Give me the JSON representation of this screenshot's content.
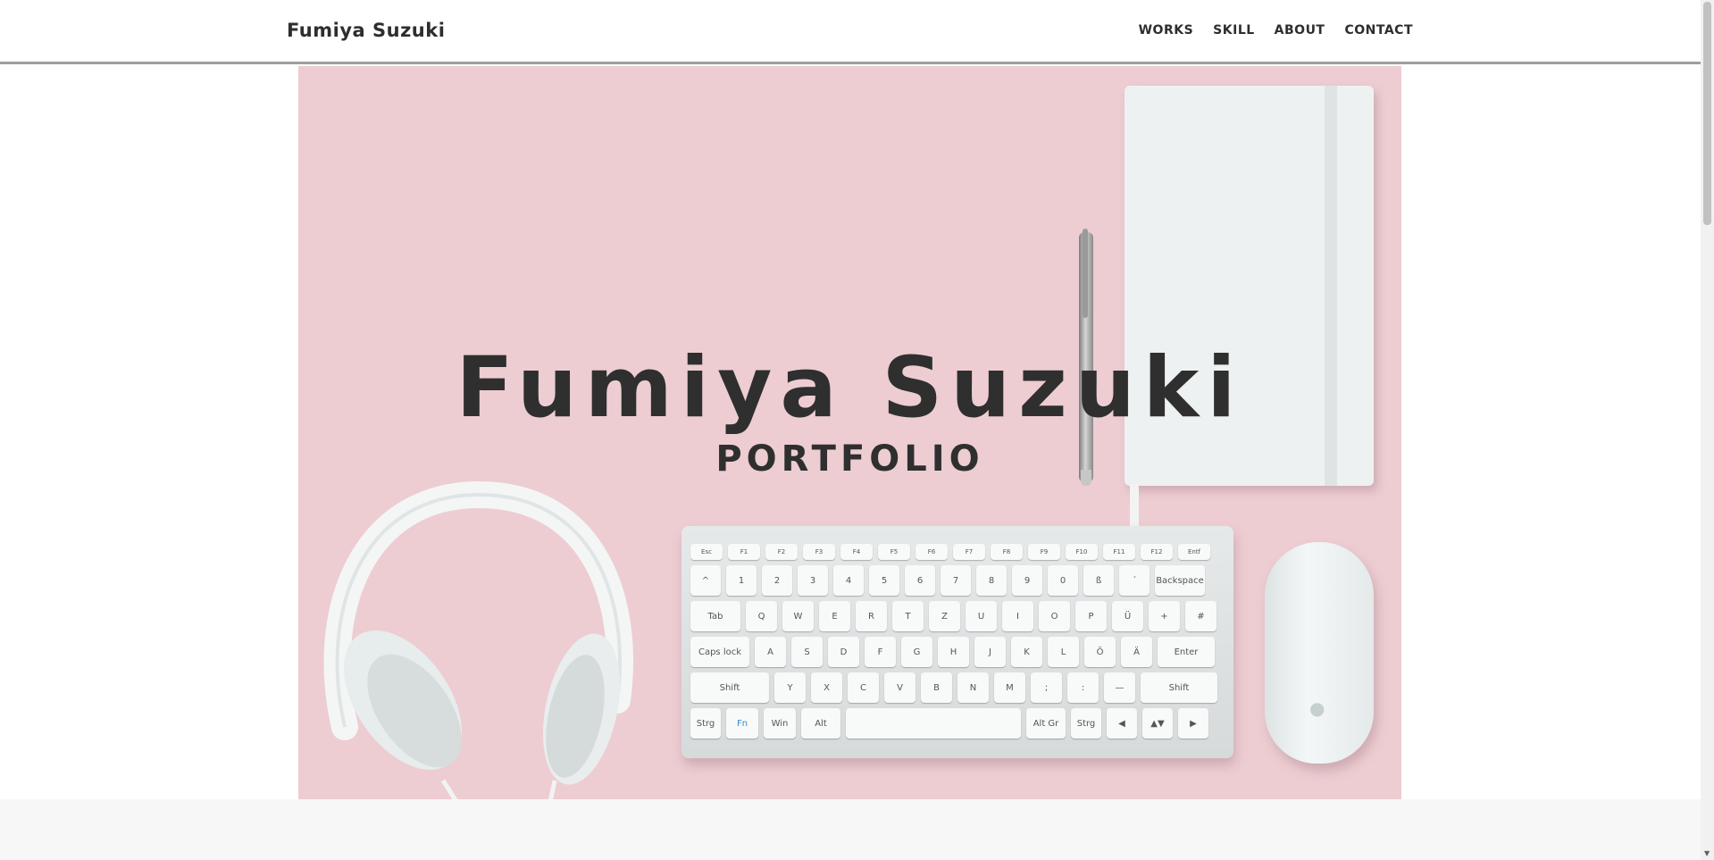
{
  "header": {
    "brand": "Fumiya Suzuki",
    "nav": [
      "WORKS",
      "SKILL",
      "ABOUT",
      "CONTACT"
    ]
  },
  "hero": {
    "title": "Fumiya Suzuki",
    "subtitle": "PORTFOLIO",
    "background_color": "#edcdd2"
  },
  "keyboard": {
    "rows": [
      [
        "Esc",
        "F1",
        "F2",
        "F3",
        "F4",
        "F5",
        "F6",
        "F7",
        "F8",
        "F9",
        "F10",
        "F11",
        "F12",
        "Entf"
      ],
      [
        "^",
        "1",
        "2",
        "3",
        "4",
        "5",
        "6",
        "7",
        "8",
        "9",
        "0",
        "ß",
        "´",
        "Backspace"
      ],
      [
        "Tab",
        "Q",
        "W",
        "E",
        "R",
        "T",
        "Z",
        "U",
        "I",
        "O",
        "P",
        "Ü",
        "+",
        "#"
      ],
      [
        "Caps lock",
        "A",
        "S",
        "D",
        "F",
        "G",
        "H",
        "J",
        "K",
        "L",
        "Ö",
        "Ä",
        "Enter"
      ],
      [
        "Shift",
        "Y",
        "X",
        "C",
        "V",
        "B",
        "N",
        "M",
        ";",
        ":",
        "—",
        "Shift"
      ],
      [
        "Strg",
        "Fn",
        "Win",
        "Alt",
        "",
        "Alt Gr",
        "Strg",
        "◀",
        "▲▼",
        "▶"
      ]
    ]
  },
  "colors": {
    "text": "#2f2f2f",
    "header_border": "#9e9e9e",
    "page_bottom": "#f7f7f7"
  }
}
